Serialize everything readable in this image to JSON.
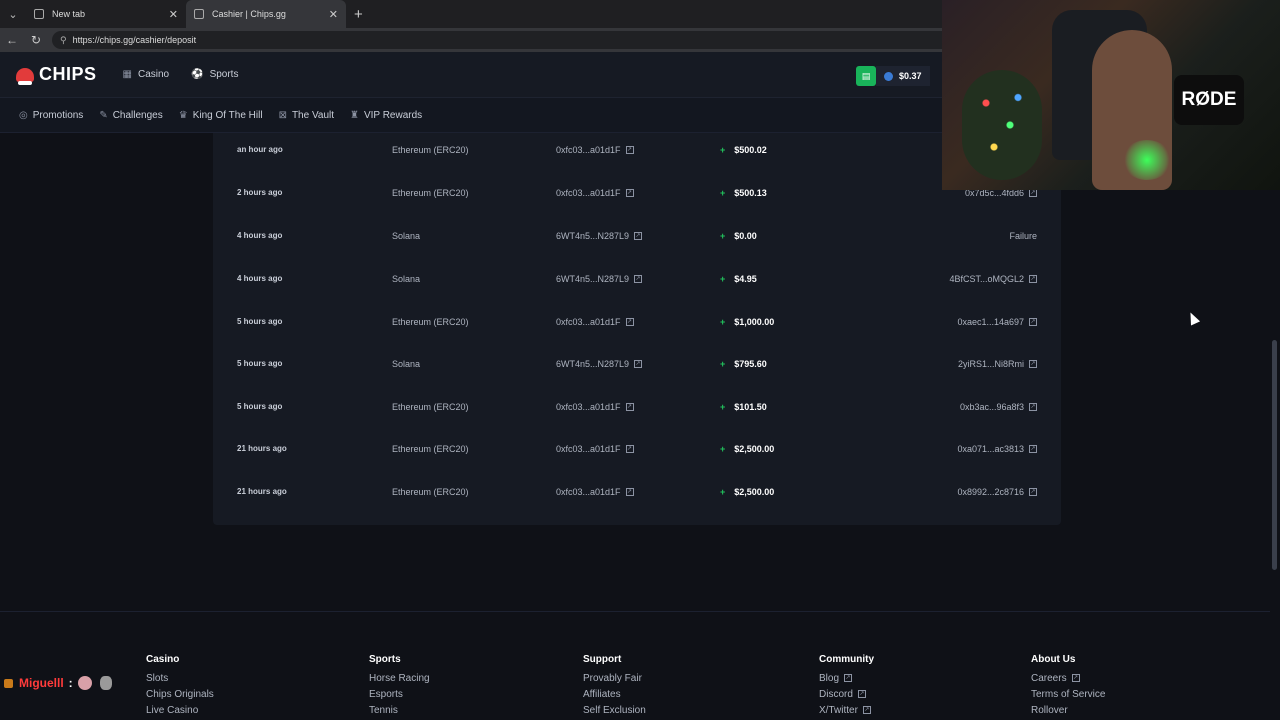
{
  "browser": {
    "tabs": [
      {
        "title": "New tab",
        "active": false
      },
      {
        "title": "Cashier | Chips.gg",
        "active": true
      }
    ],
    "url": "https://chips.gg/cashier/deposit"
  },
  "header": {
    "logo": "CHIPS",
    "nav": [
      {
        "label": "Casino",
        "icon": "casino-icon"
      },
      {
        "label": "Sports",
        "icon": "sports-icon"
      }
    ],
    "balance": "$0.37"
  },
  "subnav": [
    {
      "label": "Promotions",
      "icon": "promotions-icon"
    },
    {
      "label": "Challenges",
      "icon": "challenges-icon"
    },
    {
      "label": "King Of The Hill",
      "icon": "crown-icon"
    },
    {
      "label": "The Vault",
      "icon": "vault-icon"
    },
    {
      "label": "VIP Rewards",
      "icon": "vip-icon"
    }
  ],
  "transactions": [
    {
      "time": "an hour ago",
      "network": "Ethereum (ERC20)",
      "address": "0xfc03...a01d1F",
      "amount": "$500.02",
      "tx": ""
    },
    {
      "time": "2 hours ago",
      "network": "Ethereum (ERC20)",
      "address": "0xfc03...a01d1F",
      "amount": "$500.13",
      "tx": "0x7d5c...4fdd6"
    },
    {
      "time": "4 hours ago",
      "network": "Solana",
      "address": "6WT4n5...N287L9",
      "amount": "$0.00",
      "tx": "Failure"
    },
    {
      "time": "4 hours ago",
      "network": "Solana",
      "address": "6WT4n5...N287L9",
      "amount": "$4.95",
      "tx": "4BfCST...oMQGL2"
    },
    {
      "time": "5 hours ago",
      "network": "Ethereum (ERC20)",
      "address": "0xfc03...a01d1F",
      "amount": "$1,000.00",
      "tx": "0xaec1...14a697"
    },
    {
      "time": "5 hours ago",
      "network": "Solana",
      "address": "6WT4n5...N287L9",
      "amount": "$795.60",
      "tx": "2yiRS1...Ni8Rmi"
    },
    {
      "time": "5 hours ago",
      "network": "Ethereum (ERC20)",
      "address": "0xfc03...a01d1F",
      "amount": "$101.50",
      "tx": "0xb3ac...96a8f3"
    },
    {
      "time": "21 hours ago",
      "network": "Ethereum (ERC20)",
      "address": "0xfc03...a01d1F",
      "amount": "$2,500.00",
      "tx": "0xa071...ac3813"
    },
    {
      "time": "21 hours ago",
      "network": "Ethereum (ERC20)",
      "address": "0xfc03...a01d1F",
      "amount": "$2,500.00",
      "tx": "0x8992...2c8716"
    }
  ],
  "footer": {
    "columns": [
      {
        "heading": "Casino",
        "links": [
          "Slots",
          "Chips Originals",
          "Live Casino"
        ]
      },
      {
        "heading": "Sports",
        "links": [
          "Horse Racing",
          "Esports",
          "Tennis"
        ]
      },
      {
        "heading": "Support",
        "links": [
          "Provably Fair",
          "Affiliates",
          "Self Exclusion"
        ]
      },
      {
        "heading": "Community",
        "links": [
          "Blog",
          "Discord",
          "X/Twitter"
        ]
      },
      {
        "heading": "About Us",
        "links": [
          "Careers",
          "Terms of Service",
          "Rollover"
        ]
      }
    ]
  },
  "chat": {
    "name": "Miguelll",
    "separator": ":"
  },
  "webcam": {
    "mic_label": "RØDE"
  },
  "colors": {
    "accent_green": "#22c55e",
    "brand_red": "#e23b3b",
    "background": "#0f1117",
    "panel": "#161a23"
  }
}
